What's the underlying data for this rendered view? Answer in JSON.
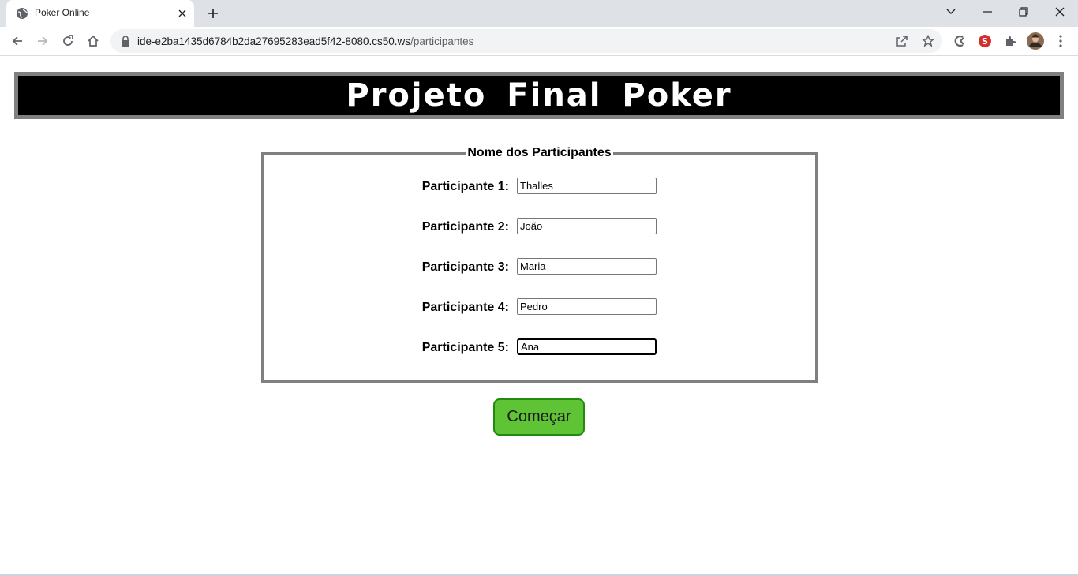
{
  "browser": {
    "tab_title": "Poker Online",
    "url_host": "ide-e2ba1435d6784b2da27695283ead5f42-8080.cs50.ws",
    "url_path": "/participantes"
  },
  "page": {
    "banner_title": "Projeto Final Poker",
    "fieldset_legend": "Nome dos Participantes",
    "participants": [
      {
        "label": "Participante 1:",
        "value": "Thalles"
      },
      {
        "label": "Participante 2:",
        "value": "João"
      },
      {
        "label": "Participante 3:",
        "value": "Maria"
      },
      {
        "label": "Participante 4:",
        "value": "Pedro"
      },
      {
        "label": "Participante 5:",
        "value": "Ana"
      }
    ],
    "start_button": "Começar"
  },
  "colors": {
    "banner_bg": "#000000",
    "banner_border": "#808080",
    "button_bg": "#5ec436",
    "button_border": "#228b0f"
  }
}
